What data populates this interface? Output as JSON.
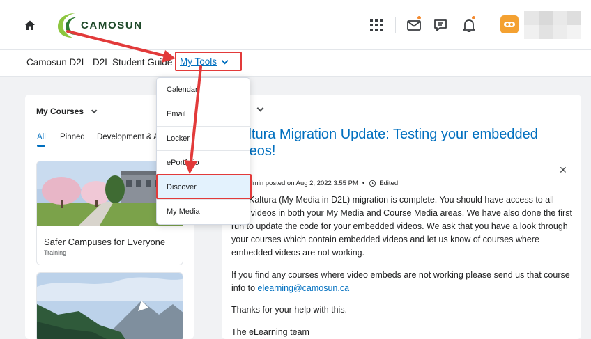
{
  "header": {
    "logo_text": "CAMOSUN",
    "accent": "#006fbf",
    "notification_dot": "#f38a2f",
    "avatar_color": "#f4a131"
  },
  "nav": {
    "items": [
      "Camosun D2L",
      "D2L Student Guide"
    ],
    "my_tools": "My Tools"
  },
  "my_tools_menu": {
    "items": [
      "Calendar",
      "Email",
      "Locker",
      "ePortfolio",
      "Discover",
      "My Media"
    ],
    "highlighted": "Discover"
  },
  "my_courses": {
    "title": "My Courses",
    "tabs": [
      "All",
      "Pinned",
      "Development & A"
    ],
    "cards": [
      {
        "title": "Safer Campuses for Everyone",
        "subtitle": "Training"
      }
    ]
  },
  "announcement": {
    "title": "Kaltura Migration Update: Testing your embedded videos!",
    "byline": "D2L Admin posted on Aug 2, 2022 3:55 PM",
    "edited": "Edited",
    "paragraphs": [
      "The Kaltura (My Media in D2L) migration is complete. You should have access to all your videos in both your My Media and Course Media areas. We have also done the first run to update the code for your embedded videos. We ask that you have a look through your courses which contain embedded videos and let us know of courses where embedded videos are not working.",
      "If you find any courses where video embeds are not working please send us that course info to",
      "Thanks for your help with this.",
      "The eLearning team"
    ],
    "email": "elearning@camosun.ca"
  },
  "annotation_color": "#e23a3a"
}
